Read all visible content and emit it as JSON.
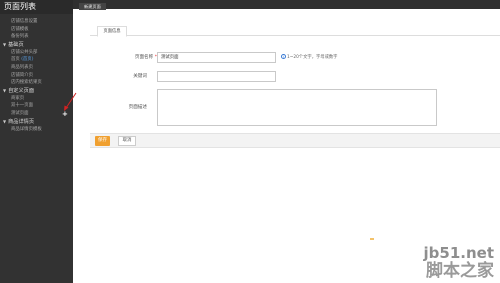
{
  "sidebar": {
    "title": "页面列表",
    "group0_items": [
      "店铺信息设置",
      "店铺模板",
      "备份列表"
    ],
    "sections": [
      {
        "label": "基础页",
        "items": [
          "店铺公共头部",
          "首页",
          "商品列表页",
          "店铺简介页",
          "店内搜索结果页"
        ],
        "tag": "(首页)"
      },
      {
        "label": "自定义页面",
        "items": [
          "商家页",
          "双十一页面",
          "测试页面"
        ]
      },
      {
        "label": "商品详情页",
        "items": [
          "商品详情页模板"
        ]
      }
    ]
  },
  "topbar": {
    "tab_label": "新建页面"
  },
  "form": {
    "tab_label": "页面信息",
    "name_label": "页面名称",
    "name_value": "测试页面",
    "name_hint": "1~20个文字，字母或数字",
    "keyword_label": "关键词",
    "desc_label": "页面描述",
    "required_mark": "*",
    "info_glyph": "i"
  },
  "buttons": {
    "save": "保存",
    "cancel": "取消"
  },
  "watermark": {
    "line1": "jb51.net",
    "line2": "脚本之家"
  },
  "colors": {
    "accent_save": "#f0a030",
    "sidebar_bg": "#323232",
    "arrow": "#d22222"
  }
}
